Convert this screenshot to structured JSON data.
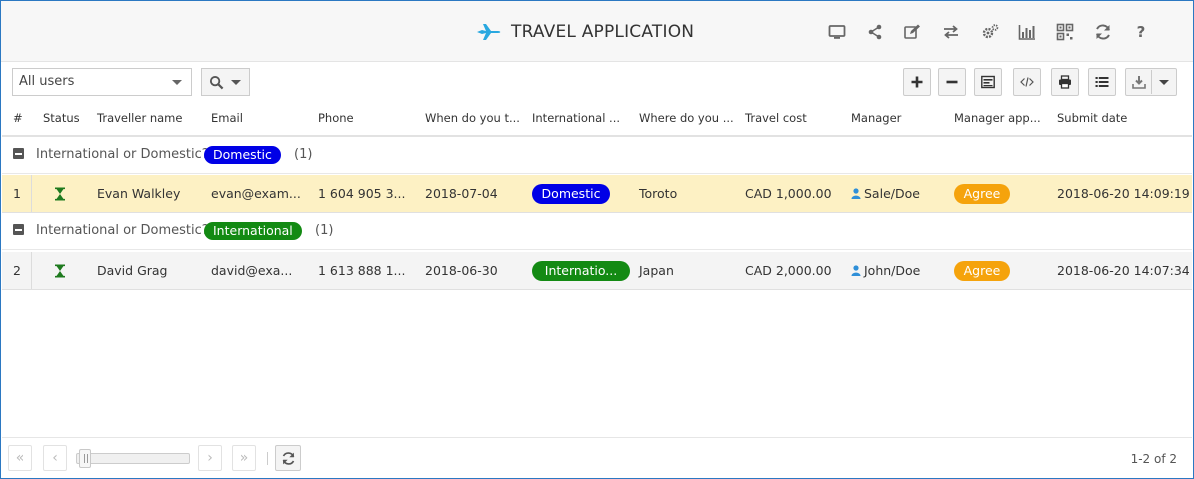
{
  "header": {
    "title": "TRAVEL APPLICATION",
    "icons": [
      "monitor-icon",
      "share-icon",
      "edit-icon",
      "swap-icon",
      "settings-icon",
      "bar-chart-icon",
      "qr-code-icon",
      "refresh-icon",
      "help-icon"
    ],
    "help_glyph": "?"
  },
  "toolbar": {
    "user_filter": "All users",
    "buttons": [
      "add-icon",
      "remove-icon",
      "form-icon",
      "code-icon",
      "print-icon",
      "list-icon",
      "download-icon"
    ]
  },
  "columns": [
    "#",
    "Status",
    "Traveller name",
    "Email",
    "Phone",
    "When do you t...",
    "International ...",
    "Where do you ...",
    "Travel cost",
    "Manager",
    "Manager app...",
    "Submit date"
  ],
  "groups": [
    {
      "label": "International or Domestic?:",
      "value": "Domestic",
      "color": "#0000e6",
      "count": "(1)",
      "rows": [
        {
          "num": "1",
          "name": "Evan Walkley",
          "email": "evan@exam...",
          "phone": "1 604 905 3...",
          "when": "2018-07-04",
          "intl": "Domestic",
          "where": "Toroto",
          "cost": "CAD 1,000.00",
          "manager": "Sale/Doe",
          "approval": "Agree",
          "submit": "2018-06-20 14:09:19"
        }
      ]
    },
    {
      "label": "International or Domestic?:",
      "value": "International",
      "color": "#138a13",
      "count": "(1)",
      "rows": [
        {
          "num": "2",
          "name": "David Grag",
          "email": "david@exa...",
          "phone": "1 613 888 1...",
          "when": "2018-06-30",
          "intl": "Internatio...",
          "where": "Japan",
          "cost": "CAD 2,000.00",
          "manager": "John/Doe",
          "approval": "Agree",
          "submit": "2018-06-20 14:07:34"
        }
      ]
    }
  ],
  "colors": {
    "accent": "#2b78c2",
    "selected_row": "#fdf1c4",
    "agree": "#f5a30c",
    "status_icon": "#1e7a1e",
    "plane": "#29a8e0"
  },
  "pager": {
    "info": "1-2 of 2",
    "first": "«",
    "prev": "‹",
    "next": "›",
    "last": "»"
  }
}
